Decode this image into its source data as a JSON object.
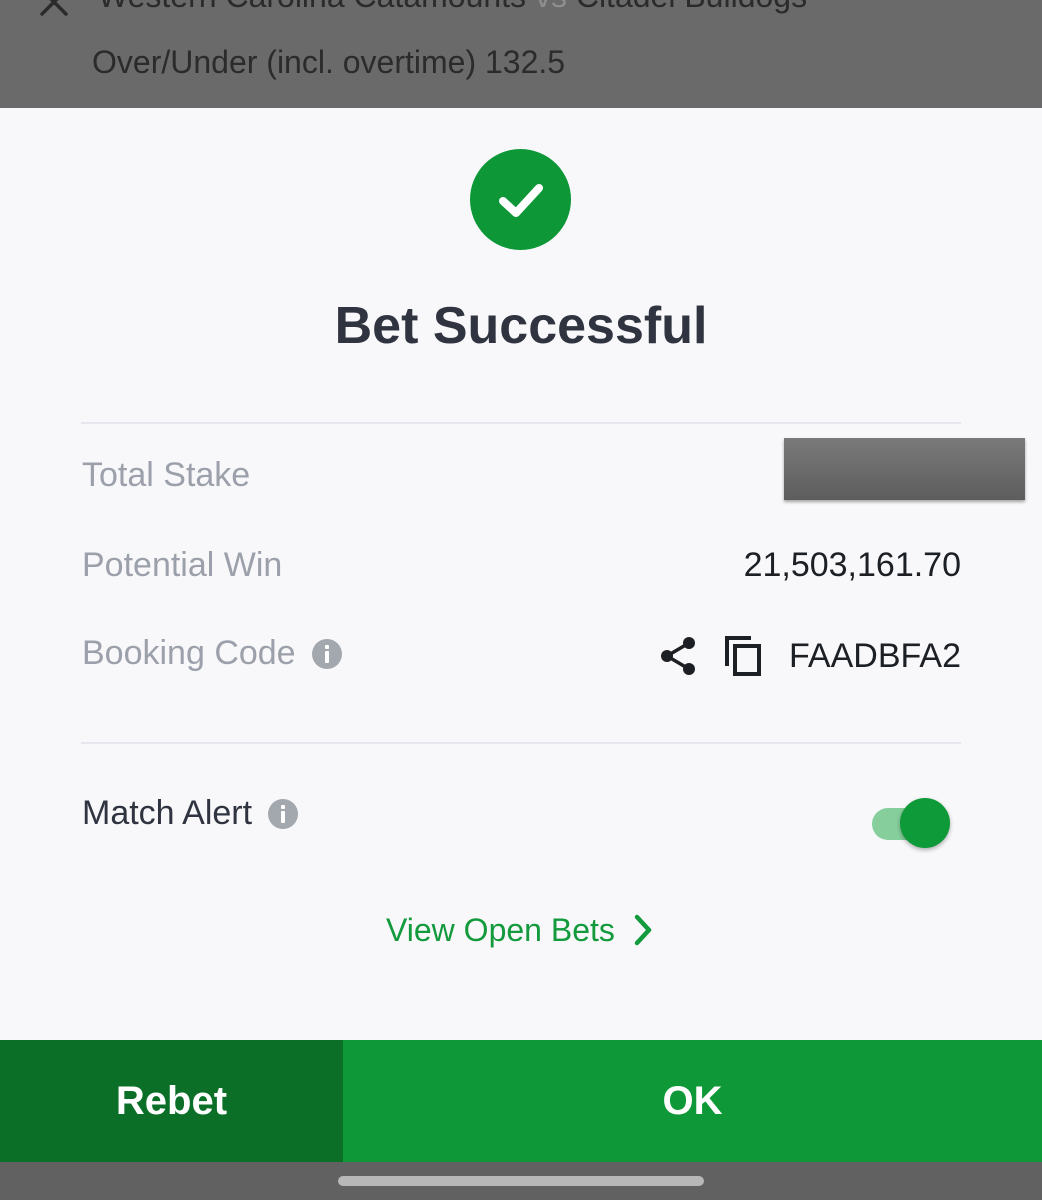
{
  "background": {
    "match": {
      "home": "Western Carolina Catamounts",
      "vs": "vs",
      "away": "Citadel Bulldogs"
    },
    "market": "Over/Under (incl. overtime) 132.5",
    "close_icon": "close-icon"
  },
  "sheet": {
    "status_icon": "check-circle-icon",
    "title": "Bet Successful",
    "total_stake": {
      "label": "Total Stake",
      "value_redacted": true
    },
    "potential_win": {
      "label": "Potential Win",
      "value": "21,503,161.70"
    },
    "booking_code": {
      "label": "Booking Code",
      "info_icon": "info-icon",
      "share_icon": "share-icon",
      "copy_icon": "copy-icon",
      "value": "FAADBFA2"
    },
    "match_alert": {
      "label": "Match Alert",
      "info_icon": "info-icon",
      "enabled": true
    },
    "view_open_bets": "View Open Bets"
  },
  "footer": {
    "rebet_label": "Rebet",
    "ok_label": "OK"
  },
  "colors": {
    "brand_green": "#0f9838",
    "dark_green": "#0b6f27",
    "link_green": "#129a3d",
    "toggle_track": "#86cf9c"
  }
}
